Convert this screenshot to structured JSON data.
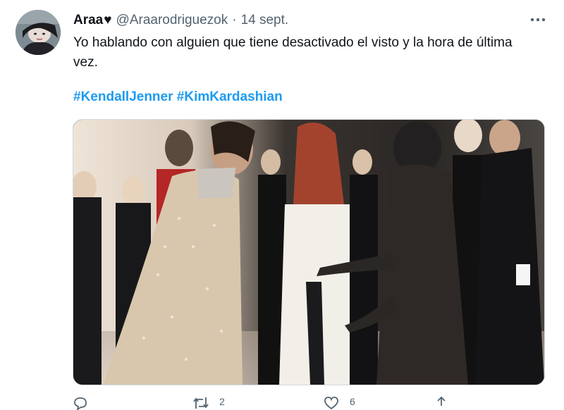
{
  "author": {
    "display_name": "Araa",
    "heart_emoji": "♥",
    "handle": "@Araarodriguezok",
    "separator": "·",
    "date": "14 sept."
  },
  "more_icon": "more-horizontal-icon",
  "tweet_text": "Yo hablando con alguien que tiene desactivado el visto y la hora de última vez.",
  "hashtags": [
    "#KendallJenner",
    "#KimKardashian"
  ],
  "actions": {
    "reply_count": "",
    "retweet_count": "2",
    "like_count": "6",
    "icons": [
      "reply-icon",
      "retweet-icon",
      "like-icon",
      "share-icon"
    ]
  },
  "colors": {
    "link": "#1d9bf0",
    "secondary_text": "#536471"
  }
}
